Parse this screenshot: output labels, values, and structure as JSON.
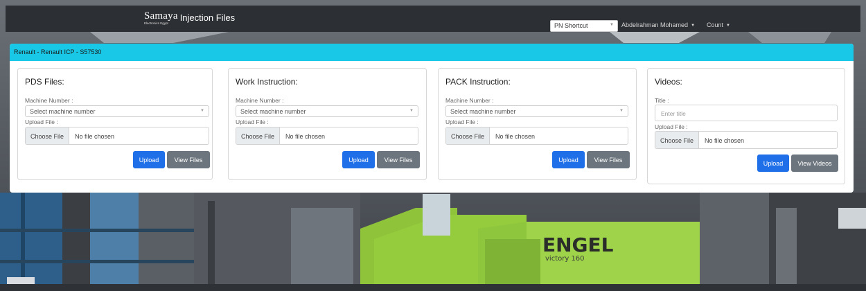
{
  "navbar": {
    "logo_text": "Samaya",
    "logo_subtext": "Electronics Egypt",
    "app_title": "Injection Files",
    "pn_shortcut": "PN Shortcut",
    "user_menu": "Abdelrahman Mohamed",
    "count_menu": "Count"
  },
  "card": {
    "header": "Renault - Renault ICP - S57530"
  },
  "panels": {
    "pds": {
      "title": "PDS Files:",
      "machine_label": "Machine Number :",
      "machine_placeholder": "Select machine number",
      "upload_label": "Upload File :",
      "choose_file": "Choose File",
      "no_file": "No file chosen",
      "upload_btn": "Upload",
      "view_btn": "View Files"
    },
    "work": {
      "title": "Work Instruction:",
      "machine_label": "Machine Number :",
      "machine_placeholder": "Select machine number",
      "upload_label": "Upload File :",
      "choose_file": "Choose File",
      "no_file": "No file chosen",
      "upload_btn": "Upload",
      "view_btn": "View Files"
    },
    "pack": {
      "title": "PACK Instruction:",
      "machine_label": "Machine Number :",
      "machine_placeholder": "Select machine number",
      "upload_label": "Upload File :",
      "choose_file": "Choose File",
      "no_file": "No file chosen",
      "upload_btn": "Upload",
      "view_btn": "View Files"
    },
    "videos": {
      "title": "Videos:",
      "title_label": "Title :",
      "title_placeholder": "Enter title",
      "upload_label": "Upload File :",
      "choose_file": "Choose File",
      "no_file": "No file chosen",
      "upload_btn": "Upload",
      "view_btn": "View Videos"
    }
  },
  "background": {
    "machine_brand": "ENGEL",
    "machine_model": "victory 160"
  },
  "colors": {
    "navbar": "#2c2f33",
    "card_header": "#19c8e6",
    "primary": "#1f6fe8",
    "secondary": "#6c757d"
  }
}
